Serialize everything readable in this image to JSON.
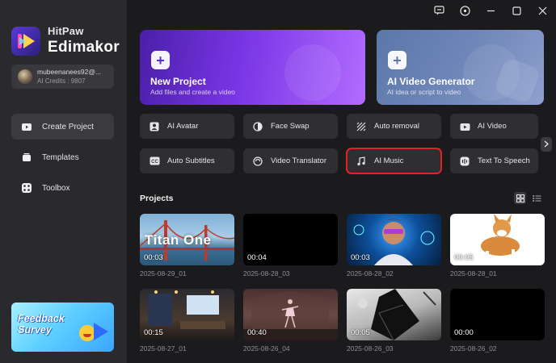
{
  "app": {
    "brand_small": "HitPaw",
    "brand_big": "Edimakor"
  },
  "user": {
    "name": "mubeenanees92@...",
    "credits": "AI Credits : 9807"
  },
  "sidebar": {
    "items": [
      {
        "label": "Create Project",
        "icon": "play-box-icon",
        "active": true
      },
      {
        "label": "Templates",
        "icon": "stack-icon",
        "active": false
      },
      {
        "label": "Toolbox",
        "icon": "grid-dots-icon",
        "active": false
      }
    ],
    "feedback": {
      "line1": "Feedback",
      "line2": "Survey"
    }
  },
  "hero": {
    "new_project": {
      "title": "New Project",
      "subtitle": "Add files and create a video"
    },
    "ai_video_generator": {
      "title": "AI Video Generator",
      "subtitle": "AI idea or script to video"
    }
  },
  "features": [
    {
      "label": "AI Avatar",
      "icon": "avatar-icon"
    },
    {
      "label": "Face Swap",
      "icon": "face-swap-icon"
    },
    {
      "label": "Auto removal",
      "icon": "auto-removal-icon"
    },
    {
      "label": "AI Video",
      "icon": "ai-video-icon"
    },
    {
      "label": "Auto Subtitles",
      "icon": "subtitles-icon"
    },
    {
      "label": "Video Translator",
      "icon": "translate-icon"
    },
    {
      "label": "AI Music",
      "icon": "music-icon",
      "highlighted": true
    },
    {
      "label": "Text To Speech",
      "icon": "speech-icon"
    }
  ],
  "projects": {
    "title": "Projects",
    "items": [
      {
        "duration": "00:03",
        "date": "2025-08-29_01",
        "overlay_text": "Titan One"
      },
      {
        "duration": "00:04",
        "date": "2025-08-28_03",
        "overlay_text": ""
      },
      {
        "duration": "00:03",
        "date": "2025-08-28_02",
        "overlay_text": ""
      },
      {
        "duration": "00:05",
        "date": "2025-08-28_01",
        "overlay_text": ""
      },
      {
        "duration": "00:15",
        "date": "2025-08-27_01",
        "overlay_text": ""
      },
      {
        "duration": "00:40",
        "date": "2025-08-26_04",
        "overlay_text": ""
      },
      {
        "duration": "00:05",
        "date": "2025-08-26_03",
        "overlay_text": ""
      },
      {
        "duration": "00:00",
        "date": "2025-08-26_02",
        "overlay_text": ""
      }
    ]
  },
  "colors": {
    "highlight": "#e02424",
    "sidebar_bg": "#2a2a2e",
    "main_bg": "#1b1b1e",
    "new_project_accent": "#7a35e6"
  }
}
